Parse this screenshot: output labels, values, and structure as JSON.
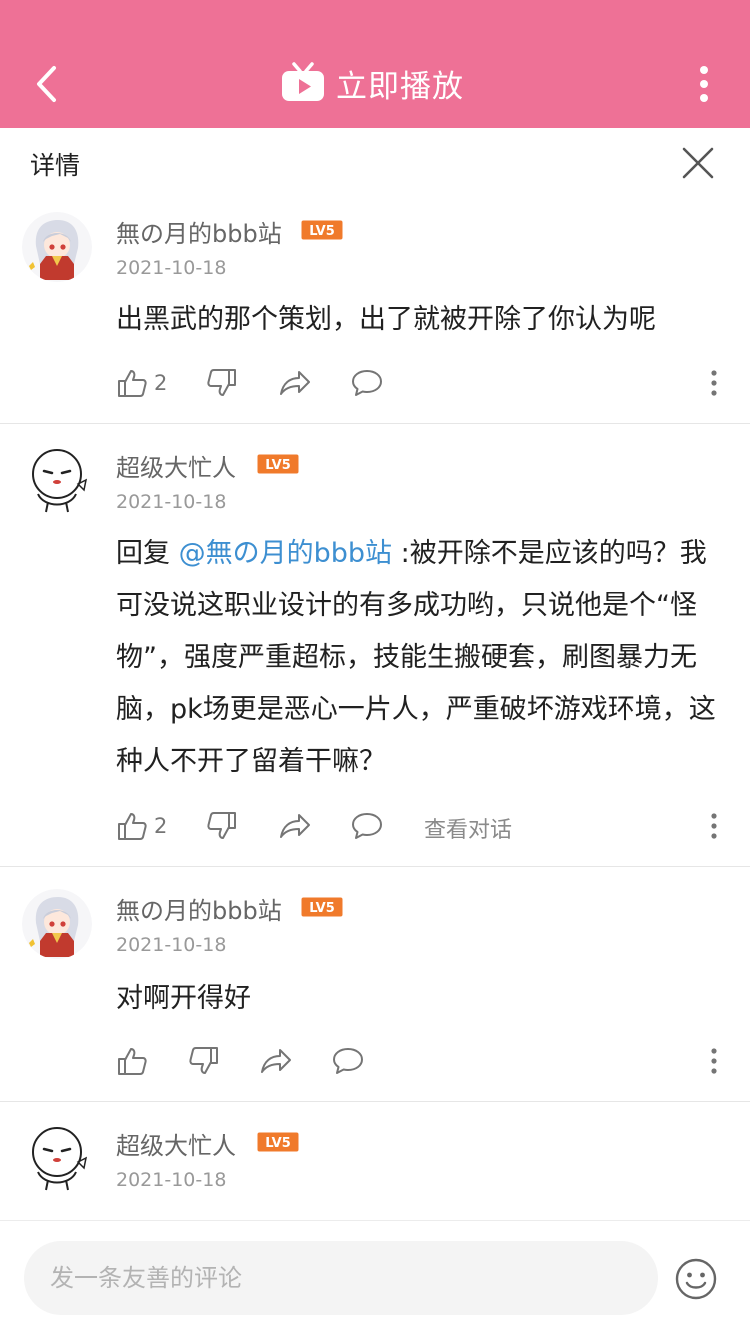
{
  "topbar": {
    "play_label": "立即播放",
    "bg_color": "#ee7196"
  },
  "detail": {
    "title": "详情"
  },
  "level_badge": "LV5",
  "comments": [
    {
      "user": "無の月的bbb站",
      "date": "2021-10-18",
      "text": "出黑武的那个策划，出了就被开除了你认为呢",
      "likes": "2"
    },
    {
      "user": "超级大忙人",
      "date": "2021-10-18",
      "reply_prefix": "回复 ",
      "mention": "@無の月的bbb站",
      "text": " :被开除不是应该的吗？我可没说这职业设计的有多成功哟，只说他是个“怪物”，强度严重超标，技能生搬硬套，刷图暴力无脑，pk场更是恶心一片人，严重破坏游戏环境，这种人不开了留着干嘛？",
      "likes": "2",
      "view_conversation": "查看对话"
    },
    {
      "user": "無の月的bbb站",
      "date": "2021-10-18",
      "text": "对啊开得好"
    },
    {
      "user": "超级大忙人",
      "date": "2021-10-18"
    }
  ],
  "input": {
    "placeholder": "发一条友善的评论"
  },
  "colors": {
    "accent": "#ee7196",
    "mention": "#3d8fd1",
    "badge": "#f07a2b"
  }
}
